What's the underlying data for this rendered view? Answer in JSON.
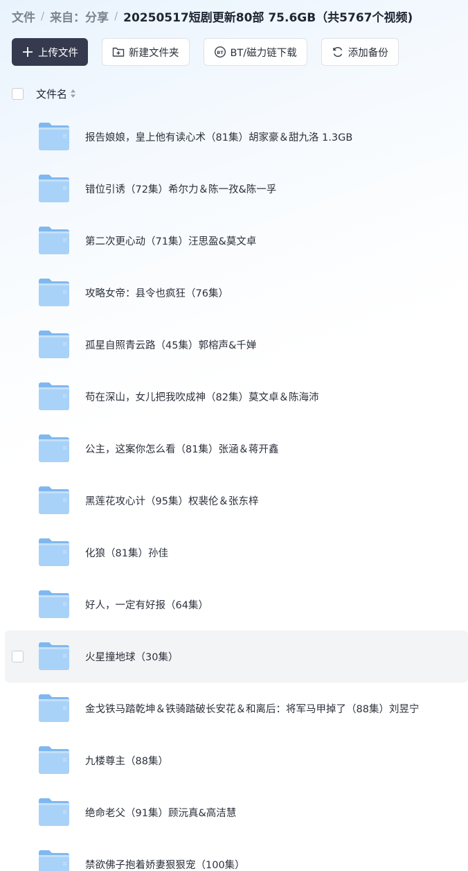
{
  "breadcrumb": {
    "items": [
      "文件",
      "来自：分享"
    ],
    "current": "20250517短剧更新80部 75.6GB（共5767个视频)",
    "separator": "/"
  },
  "toolbar": {
    "upload_label": "上传文件",
    "new_folder_label": "新建文件夹",
    "bt_label": "BT/磁力链下载",
    "backup_label": "添加备份"
  },
  "list": {
    "header_label": "文件名",
    "rows": [
      {
        "name": "报告娘娘，皇上他有读心术（81集）胡家豪＆甜九洛 1.3GB",
        "icon": "folder-icon"
      },
      {
        "name": "错位引诱（72集）希尔力＆陈一孜&陈一孚",
        "icon": "folder-icon"
      },
      {
        "name": "第二次更心动（71集）汪思盈&莫文卓",
        "icon": "folder-icon"
      },
      {
        "name": "攻略女帝：县令也疯狂（76集）",
        "icon": "folder-icon"
      },
      {
        "name": "孤星自照青云路（45集）郭榕声&千婵",
        "icon": "folder-icon"
      },
      {
        "name": "苟在深山，女儿把我吹成神（82集）莫文卓＆陈海沛",
        "icon": "folder-icon"
      },
      {
        "name": "公主，这案你怎么看（81集）张涵＆蒋开鑫",
        "icon": "folder-icon"
      },
      {
        "name": "黑莲花攻心计（95集）权裴伦＆张东梓",
        "icon": "folder-icon"
      },
      {
        "name": "化狼（81集）孙佳",
        "icon": "folder-icon"
      },
      {
        "name": "好人，一定有好报（64集）",
        "icon": "folder-icon"
      },
      {
        "name": "火星撞地球（30集）",
        "icon": "folder-icon",
        "hover": true
      },
      {
        "name": "金戈铁马踏乾坤＆铁骑踏破长安花＆和离后：将军马甲掉了（88集）刘昱宁",
        "icon": "folder-icon"
      },
      {
        "name": "九楼尊主（88集）",
        "icon": "folder-icon"
      },
      {
        "name": "绝命老父（91集）顾沅真&高洁慧",
        "icon": "folder-icon"
      },
      {
        "name": "禁欲佛子抱着娇妻狠狠宠（100集）",
        "icon": "folder-icon"
      }
    ]
  },
  "colors": {
    "primary_button": "#363a4f",
    "folder_top": "#7fb8f0",
    "folder_body": "#a9d2f8",
    "hover_row": "#f3f4f6"
  }
}
